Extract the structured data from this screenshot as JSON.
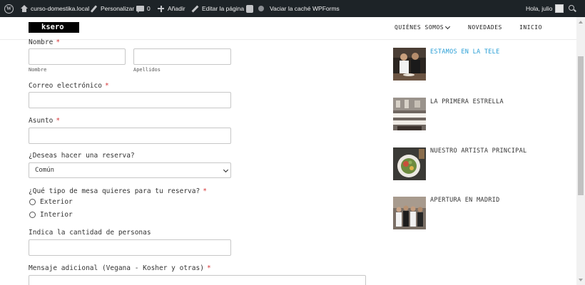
{
  "adminbar": {
    "site": "curso-domestika.local",
    "customize": "Personalizar",
    "comments_count": "0",
    "new": "Añadir",
    "edit_page": "Editar la página",
    "clear_cache": "Vaciar la caché",
    "wpforms": "WPForms",
    "greeting": "Hola, julio"
  },
  "header": {
    "logo": "ksero",
    "nav": [
      "QUIÉNES SOMOS",
      "NOVEDADES",
      "INICIO"
    ]
  },
  "form": {
    "name_label": "Nombre",
    "name_first_sub": "Nombre",
    "name_last_sub": "Apellidos",
    "email_label": "Correo electrónico",
    "subject_label": "Asunto",
    "reservation_label": "¿Deseas hacer una reserva?",
    "reservation_value": "Común",
    "table_label": "¿Qué tipo de mesa quieres para tu reserva?",
    "table_options": [
      "Exterior",
      "Interior"
    ],
    "people_label": "Indica la cantidad de personas",
    "message_label": "Mensaje adicional (Vegana - Kosher y otras)",
    "required_mark": "*"
  },
  "sidebar": {
    "posts": [
      {
        "title": "ESTAMOS EN LA TELE"
      },
      {
        "title": "LA PRIMERA ESTRELLA"
      },
      {
        "title": "NUESTRO ARTISTA PRINCIPAL"
      },
      {
        "title": "APERTURA EN MADRID"
      }
    ]
  },
  "colors": {
    "adminbar_bg": "#1d2327",
    "link_active": "#2a9fd6",
    "required": "#d63638"
  }
}
